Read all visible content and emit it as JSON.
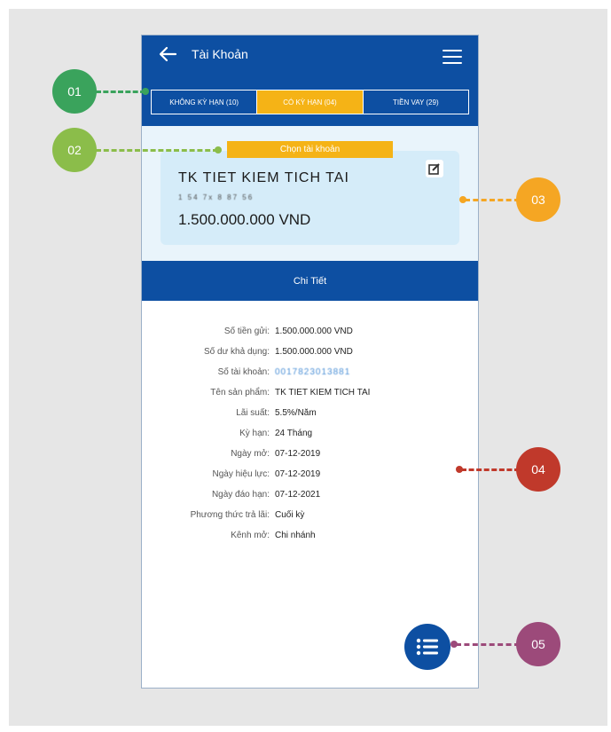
{
  "header": {
    "title": "Tài Khoản"
  },
  "tabs": [
    {
      "label": "KHÔNG KỲ HẠN (10)",
      "active": false
    },
    {
      "label": "CÓ KỲ HẠN (04)",
      "active": true
    },
    {
      "label": "TIỀN VAY (29)",
      "active": false
    }
  ],
  "account": {
    "choose_label": "Chọn tài khoản",
    "name": "TK TIET KIEM TICH TAI",
    "number_masked": "1 54 7x 8 87 56",
    "balance": "1.500.000.000 VND"
  },
  "detail_bar_label": "Chi Tiết",
  "details": [
    {
      "label": "Số tiền gửi:",
      "value": "1.500.000.000 VND"
    },
    {
      "label": "Số dư khả dụng:",
      "value": "1.500.000.000 VND"
    },
    {
      "label": "Số tài khoản:",
      "value": "0017823013881"
    },
    {
      "label": "Tên sản phẩm:",
      "value": "TK TIET KIEM TICH TAI"
    },
    {
      "label": "Lãi suất:",
      "value": "5.5%/Năm"
    },
    {
      "label": "Kỳ hạn:",
      "value": "24 Tháng"
    },
    {
      "label": "Ngày mở:",
      "value": "07-12-2019"
    },
    {
      "label": "Ngày hiệu lực:",
      "value": "07-12-2019"
    },
    {
      "label": "Ngày đáo hạn:",
      "value": "07-12-2021"
    },
    {
      "label": "Phương thức trả lãi:",
      "value": "Cuối kỳ"
    },
    {
      "label": "Kênh mở:",
      "value": "Chi nhánh"
    }
  ],
  "markers": [
    {
      "label": "01",
      "color": "#3aa35c"
    },
    {
      "label": "02",
      "color": "#8bbd4a"
    },
    {
      "label": "03",
      "color": "#f5a623"
    },
    {
      "label": "04",
      "color": "#c0392b"
    },
    {
      "label": "05",
      "color": "#9c4a7a"
    }
  ],
  "colors": {
    "primary": "#0d4fa2",
    "accent": "#f5b316"
  },
  "icons": [
    "back-arrow-icon",
    "menu-icon",
    "edit-icon",
    "list-icon"
  ]
}
